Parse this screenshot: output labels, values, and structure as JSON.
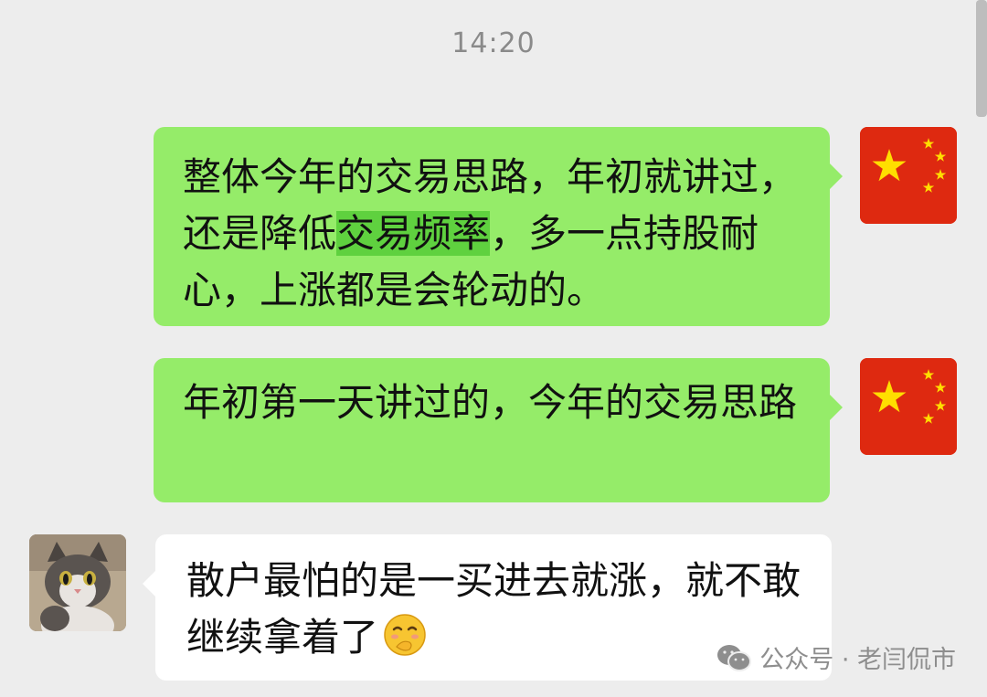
{
  "time": "14:20",
  "messages": [
    {
      "sender": "self",
      "avatar": "china-flag-avatar",
      "text_before": "整体今年的交易思路，年初就讲过，还是降低",
      "highlight": "交易频率",
      "text_after": "，多一点持股耐心，上涨都是会轮动的。"
    },
    {
      "sender": "self",
      "avatar": "china-flag-avatar",
      "text": "年初第一天讲过的，今年的交易思路"
    },
    {
      "sender": "other",
      "avatar": "cat-avatar",
      "text": "散户最怕的是一买进去就涨，就不敢继续拿着了",
      "emoji": "shy-face-emoji"
    }
  ],
  "watermark": {
    "icon": "wechat-icon",
    "text": "公众号 · 老闫侃市"
  },
  "colors": {
    "background": "#ededed",
    "self_bubble": "#95ec69",
    "other_bubble": "#ffffff",
    "highlight": "#5fd13f",
    "flag_red": "#de2910",
    "flag_yellow": "#ffde00"
  }
}
